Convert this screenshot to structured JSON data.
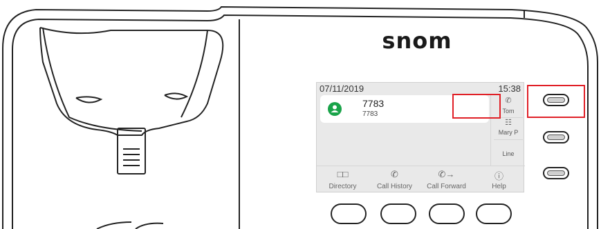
{
  "phone": {
    "brand": "snom"
  },
  "screen": {
    "date": "07/11/2019",
    "time": "15:38",
    "active_call": {
      "number": "7783",
      "sub_number": "7783"
    },
    "side_keys": [
      {
        "icon": "phone-icon",
        "label": "Tom"
      },
      {
        "icon": "keypad-icon",
        "label": "Mary P"
      },
      {
        "icon": "",
        "label": "Line"
      }
    ],
    "softkeys": [
      {
        "icon": "book-icon",
        "label": "Directory"
      },
      {
        "icon": "call-history-icon",
        "label": "Call History"
      },
      {
        "icon": "call-forward-icon",
        "label": "Call Forward"
      },
      {
        "icon": "help-icon",
        "label": "Help"
      }
    ]
  },
  "highlight_color": "#e01f26",
  "accent_color": "#19a349"
}
